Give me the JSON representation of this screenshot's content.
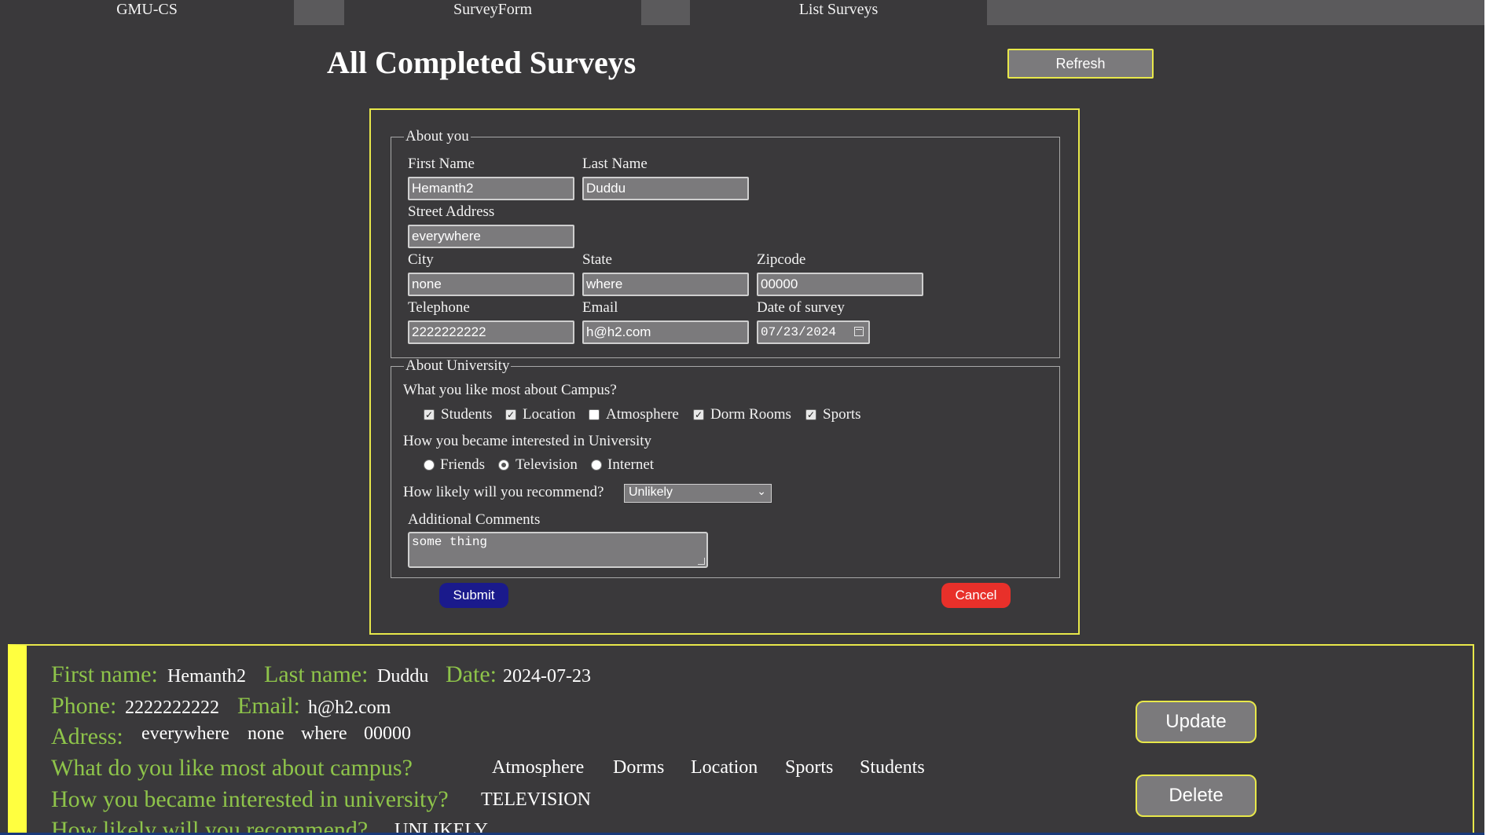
{
  "tabs": [
    "GMU-CS",
    "SurveyForm",
    "List Surveys"
  ],
  "header": {
    "title": "All Completed Surveys",
    "refresh_label": "Refresh"
  },
  "colors": {
    "accent_border": "#e8e84a",
    "card_stripe": "#ffff40",
    "label_green": "#8ec44a",
    "submit": "#1a1a8c",
    "cancel": "#e8302a"
  },
  "form": {
    "about_you": {
      "legend": "About you",
      "first_name": {
        "label": "First Name",
        "value": "Hemanth2"
      },
      "last_name": {
        "label": "Last Name",
        "value": "Duddu"
      },
      "street": {
        "label": "Street Address",
        "value": "everywhere"
      },
      "city": {
        "label": "City",
        "value": "none"
      },
      "state": {
        "label": "State",
        "value": "where"
      },
      "zipcode": {
        "label": "Zipcode",
        "value": "00000"
      },
      "telephone": {
        "label": "Telephone",
        "value": "2222222222"
      },
      "email": {
        "label": "Email",
        "value": "h@h2.com"
      },
      "date": {
        "label": "Date of survey",
        "value": "07/23/2024"
      }
    },
    "about_university": {
      "legend": "About University",
      "like_question": "What you like most about Campus?",
      "like_options": [
        {
          "label": "Students",
          "checked": true
        },
        {
          "label": "Location",
          "checked": true
        },
        {
          "label": "Atmosphere",
          "checked": false
        },
        {
          "label": "Dorm Rooms",
          "checked": true
        },
        {
          "label": "Sports",
          "checked": true
        }
      ],
      "interest_question": "How you became interested in University",
      "interest_options": [
        {
          "label": "Friends",
          "selected": false
        },
        {
          "label": "Television",
          "selected": true
        },
        {
          "label": "Internet",
          "selected": false
        }
      ],
      "recommend_question": "How likely will you recommend?",
      "recommend_value": "Unlikely",
      "comments_label": "Additional Comments",
      "comments_value": "some thing"
    },
    "submit_label": "Submit",
    "cancel_label": "Cancel"
  },
  "survey_card": {
    "first_name_label": "First name:",
    "first_name": "Hemanth2",
    "last_name_label": "Last name:",
    "last_name": "Duddu",
    "date_label": "Date:",
    "date": "2024-07-23",
    "phone_label": "Phone:",
    "phone": "2222222222",
    "email_label": "Email:",
    "email": "h@h2.com",
    "address_label": "Adress:",
    "address_parts": [
      "everywhere",
      "none",
      "where",
      "00000"
    ],
    "like_label": "What do you like most about campus?",
    "like_values": [
      "Atmosphere",
      "Dorms",
      "Location",
      "Sports",
      "Students"
    ],
    "interest_label": "How you became interested in university?",
    "interest_value": "TELEVISION",
    "recommend_label": "How likely will you recommend?",
    "recommend_value": "UNLIKELY",
    "update_label": "Update",
    "delete_label": "Delete"
  }
}
